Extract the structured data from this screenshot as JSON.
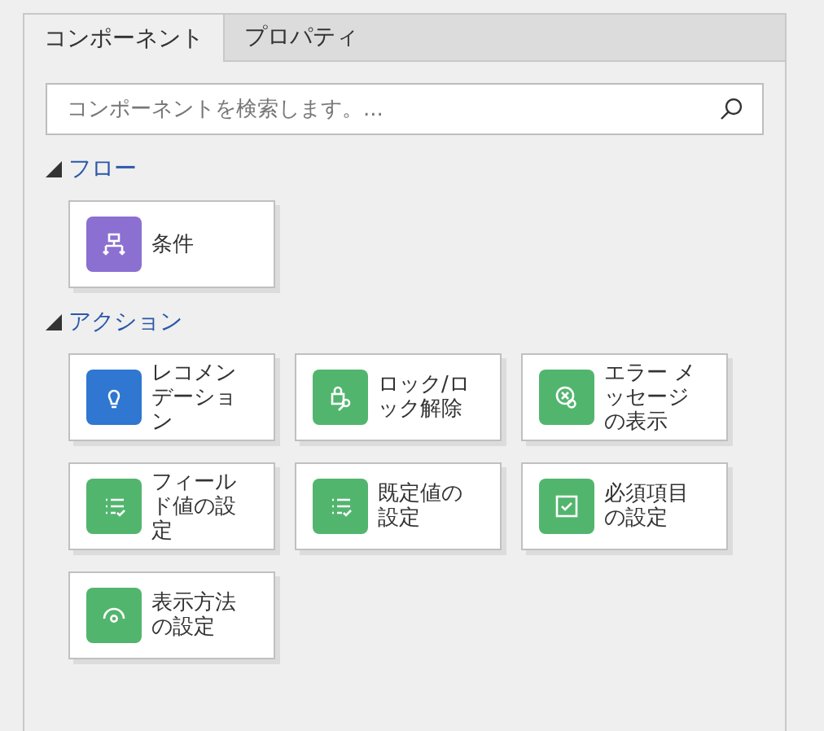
{
  "tabs": [
    {
      "label": "コンポーネント",
      "selected": true
    },
    {
      "label": "プロパティ",
      "selected": false
    }
  ],
  "search": {
    "placeholder": "コンポーネントを検索します。..."
  },
  "sections": [
    {
      "title": "フロー",
      "expanded": true,
      "items": [
        {
          "label": "条件",
          "color": "#8b6fd1"
        }
      ]
    },
    {
      "title": "アクション",
      "expanded": true,
      "items": [
        {
          "label": "レコメンデーション",
          "color": "#2f77d0"
        },
        {
          "label": "ロック/ロック解除",
          "color": "#52b56e"
        },
        {
          "label": "エラー メッセージの表示",
          "color": "#52b56e"
        },
        {
          "label": "フィールド値の設定",
          "color": "#52b56e"
        },
        {
          "label": "既定値の設定",
          "color": "#52b56e"
        },
        {
          "label": "必須項目の設定",
          "color": "#52b56e"
        },
        {
          "label": "表示方法の設定",
          "color": "#52b56e"
        }
      ]
    }
  ]
}
